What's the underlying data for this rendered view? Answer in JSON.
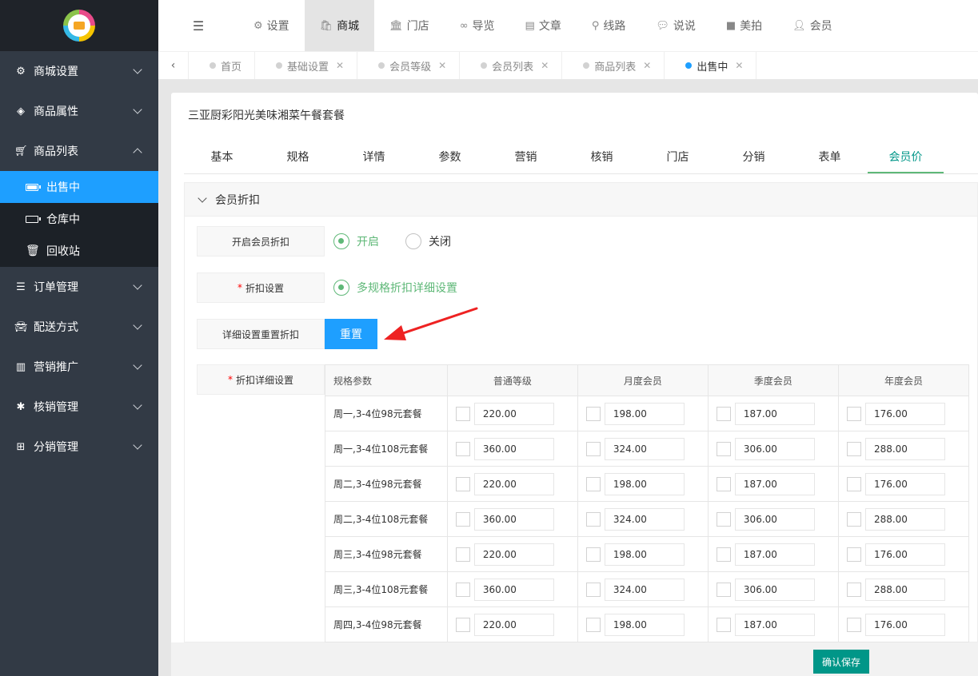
{
  "sidebar": {
    "items": [
      {
        "label": "商城设置",
        "icon": "gears-icon"
      },
      {
        "label": "商品属性",
        "icon": "cube-icon"
      },
      {
        "label": "商品列表",
        "icon": "cart-icon"
      },
      {
        "label": "订单管理",
        "icon": "list-icon"
      },
      {
        "label": "配送方式",
        "icon": "car-icon"
      },
      {
        "label": "营销推广",
        "icon": "bar-chart-icon"
      },
      {
        "label": "核销管理",
        "icon": "asterisk-icon"
      },
      {
        "label": "分销管理",
        "icon": "sitemap-icon"
      }
    ],
    "sub_items": [
      {
        "label": "出售中"
      },
      {
        "label": "仓库中"
      },
      {
        "label": "回收站"
      }
    ]
  },
  "topbar": {
    "tabs": [
      {
        "label": "设置"
      },
      {
        "label": "商城"
      },
      {
        "label": "门店"
      },
      {
        "label": "导览"
      },
      {
        "label": "文章"
      },
      {
        "label": "线路"
      },
      {
        "label": "说说"
      },
      {
        "label": "美拍"
      },
      {
        "label": "会员"
      }
    ]
  },
  "tabstrip": {
    "tabs": [
      {
        "label": "首页"
      },
      {
        "label": "基础设置"
      },
      {
        "label": "会员等级"
      },
      {
        "label": "会员列表"
      },
      {
        "label": "商品列表"
      },
      {
        "label": "出售中"
      }
    ]
  },
  "product": {
    "title": "三亚厨彩阳光美味湘菜午餐套餐"
  },
  "product_tabs": [
    "基本",
    "规格",
    "详情",
    "参数",
    "营销",
    "核销",
    "门店",
    "分销",
    "表单",
    "会员价"
  ],
  "panel": {
    "title": "会员折扣",
    "enable_label": "开启会员折扣",
    "radio_on": "开启",
    "radio_off": "关闭",
    "discount_label": "折扣设置",
    "discount_option": "多规格折扣详细设置",
    "reset_label": "详细设置重置折扣",
    "reset_button": "重置",
    "detail_label": "折扣详细设置"
  },
  "table": {
    "headers": [
      "规格参数",
      "普通等级",
      "月度会员",
      "季度会员",
      "年度会员"
    ],
    "rows": [
      {
        "name": "周一,3-4位98元套餐",
        "values": [
          "220.00",
          "198.00",
          "187.00",
          "176.00"
        ]
      },
      {
        "name": "周一,3-4位108元套餐",
        "values": [
          "360.00",
          "324.00",
          "306.00",
          "288.00"
        ]
      },
      {
        "name": "周二,3-4位98元套餐",
        "values": [
          "220.00",
          "198.00",
          "187.00",
          "176.00"
        ]
      },
      {
        "name": "周二,3-4位108元套餐",
        "values": [
          "360.00",
          "324.00",
          "306.00",
          "288.00"
        ]
      },
      {
        "name": "周三,3-4位98元套餐",
        "values": [
          "220.00",
          "198.00",
          "187.00",
          "176.00"
        ]
      },
      {
        "name": "周三,3-4位108元套餐",
        "values": [
          "360.00",
          "324.00",
          "306.00",
          "288.00"
        ]
      },
      {
        "name": "周四,3-4位98元套餐",
        "values": [
          "220.00",
          "198.00",
          "187.00",
          "176.00"
        ]
      }
    ]
  },
  "footer": {
    "save_button": "确认保存"
  },
  "colors": {
    "sidebar_bg": "#323a45",
    "active_blue": "#1e9fff",
    "green": "#5fb878",
    "teal": "#009688",
    "annotation_red": "#ee2222"
  }
}
